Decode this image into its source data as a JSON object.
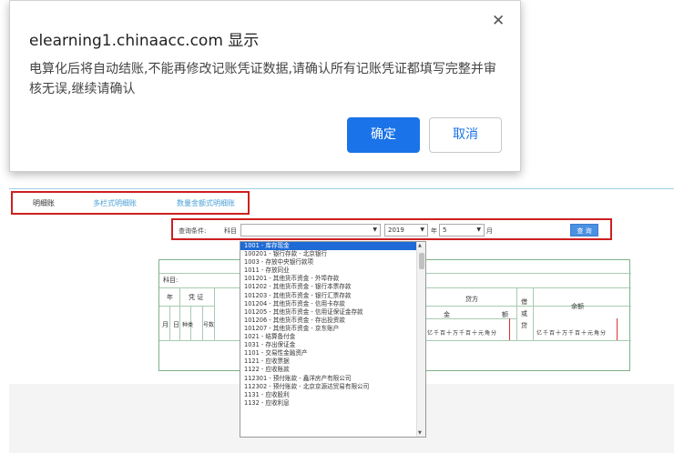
{
  "dialog": {
    "title": "elearning1.chinaacc.com 显示",
    "message": "电算化后将自动结账,不能再修改记账凭证数据,请确认所有记账凭证都填写完整并审核无误,继续请确认",
    "ok_label": "确定",
    "cancel_label": "取消",
    "close_glyph": "✕"
  },
  "tabs": [
    "明细账",
    "多栏式明细账",
    "数量金额式明细账"
  ],
  "query": {
    "condition_label": "查询条件:",
    "subject_label": "科目",
    "year_value": "2019",
    "year_label": "年",
    "month_value": "5",
    "month_label": "月",
    "search_label": "查 询",
    "arrow_glyph": "▼"
  },
  "ledger": {
    "subject_label": "科目:",
    "year_header": "年",
    "voucher_header": "凭 证",
    "month_col": "月",
    "day_col": "日",
    "type_col": "种类",
    "number_col": "号数",
    "credit_header": "贷方",
    "amount_label": "金",
    "amount_label2": "额",
    "direction_label": "借或贷",
    "balance_label": "余额",
    "digit_units": "亿千百十万千百十元角分"
  },
  "dropdown": {
    "items": [
      "1001 - 库存现金",
      "100201 - 银行存款 - 北京银行",
      "1003 - 存放中央银行款项",
      "1011 - 存放同业",
      "101201 - 其他货币资金 - 外埠存款",
      "101202 - 其他货币资金 - 银行本票存款",
      "101203 - 其他货币资金 - 银行汇票存款",
      "101204 - 其他货币资金 - 信用卡存款",
      "101205 - 其他货币资金 - 信用证保证金存款",
      "101206 - 其他货币资金 - 存出投资款",
      "101207 - 其他货币资金 - 京东账户",
      "1021 - 结算备付金",
      "1031 - 存出保证金",
      "1101 - 交易性金融资产",
      "1121 - 应收票据",
      "1122 - 应收账款",
      "112301 - 预付账款 - 鑫洋房产有限公司",
      "112302 - 预付账款 - 北京京源达贸易有限公司",
      "1131 - 应收股利",
      "1132 - 应收利息"
    ],
    "selected_index": 0
  }
}
